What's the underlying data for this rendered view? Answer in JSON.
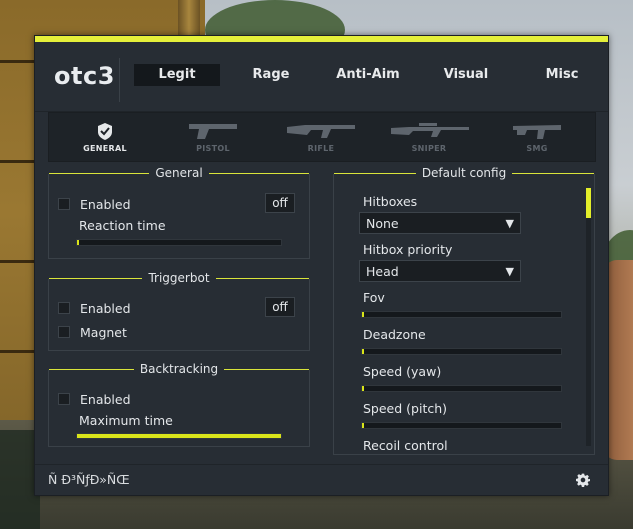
{
  "app": {
    "logo": "otc3",
    "accent": "#e5f03a"
  },
  "tabs": [
    {
      "label": "Legit",
      "active": true
    },
    {
      "label": "Rage",
      "active": false
    },
    {
      "label": "Anti-Aim",
      "active": false
    },
    {
      "label": "Visual",
      "active": false
    },
    {
      "label": "Misc",
      "active": false
    }
  ],
  "weapons": [
    {
      "label": "GENERAL",
      "icon": "shield-icon",
      "active": true
    },
    {
      "label": "PISTOL",
      "icon": "pistol-icon",
      "active": false
    },
    {
      "label": "RIFLE",
      "icon": "rifle-icon",
      "active": false
    },
    {
      "label": "SNIPER",
      "icon": "sniper-icon",
      "active": false
    },
    {
      "label": "SMG",
      "icon": "smg-icon",
      "active": false
    }
  ],
  "general": {
    "title": "General",
    "enabled_label": "Enabled",
    "enabled_value": "off",
    "reaction_label": "Reaction time",
    "reaction_level": 0.0
  },
  "triggerbot": {
    "title": "Triggerbot",
    "enabled_label": "Enabled",
    "enabled_value": "off",
    "magnet_label": "Magnet"
  },
  "backtracking": {
    "title": "Backtracking",
    "enabled_label": "Enabled",
    "max_time_label": "Maximum time",
    "max_time_level": 1.0
  },
  "default_config": {
    "title": "Default config",
    "hitboxes_label": "Hitboxes",
    "hitboxes_value": "None",
    "hitbox_priority_label": "Hitbox priority",
    "hitbox_priority_value": "Head",
    "fov_label": "Fov",
    "deadzone_label": "Deadzone",
    "speed_yaw_label": "Speed (yaw)",
    "speed_pitch_label": "Speed (pitch)",
    "recoil_label": "Recoil control"
  },
  "footer": {
    "text": "Ñ Ð³ÑƒÐ»ÑŒ",
    "settings_icon": "gear-icon"
  }
}
